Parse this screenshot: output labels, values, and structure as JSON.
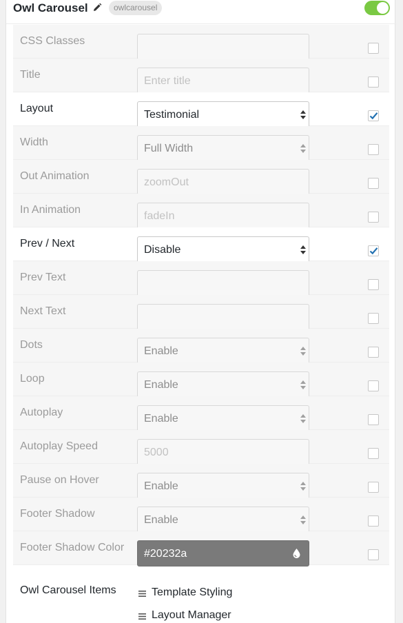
{
  "header": {
    "title": "Owl Carousel",
    "slug": "owlcarousel",
    "enabled": true
  },
  "rows": [
    {
      "label": "CSS Classes",
      "type": "text",
      "value": "",
      "placeholder": "",
      "checked": false
    },
    {
      "label": "Title",
      "type": "text",
      "value": "",
      "placeholder": "Enter title",
      "checked": false
    },
    {
      "label": "Layout",
      "type": "select",
      "value": "Testimonial",
      "placeholder": "",
      "checked": true
    },
    {
      "label": "Width",
      "type": "select",
      "value": "Full Width",
      "placeholder": "",
      "checked": false
    },
    {
      "label": "Out Animation",
      "type": "text",
      "value": "",
      "placeholder": "zoomOut",
      "checked": false
    },
    {
      "label": "In Animation",
      "type": "text",
      "value": "",
      "placeholder": "fadeIn",
      "checked": false
    },
    {
      "label": "Prev / Next",
      "type": "select",
      "value": "Disable",
      "placeholder": "",
      "checked": true
    },
    {
      "label": "Prev Text",
      "type": "text",
      "value": "",
      "placeholder": "",
      "checked": false
    },
    {
      "label": "Next Text",
      "type": "text",
      "value": "",
      "placeholder": "",
      "checked": false
    },
    {
      "label": "Dots",
      "type": "select",
      "value": "Enable",
      "placeholder": "",
      "checked": false
    },
    {
      "label": "Loop",
      "type": "select",
      "value": "Enable",
      "placeholder": "",
      "checked": false
    },
    {
      "label": "Autoplay",
      "type": "select",
      "value": "Enable",
      "placeholder": "",
      "checked": false
    },
    {
      "label": "Autoplay Speed",
      "type": "text",
      "value": "",
      "placeholder": "5000",
      "checked": false
    },
    {
      "label": "Pause on Hover",
      "type": "select",
      "value": "Enable",
      "placeholder": "",
      "checked": false
    },
    {
      "label": "Footer Shadow",
      "type": "select",
      "value": "Enable",
      "placeholder": "",
      "checked": false
    },
    {
      "label": "Footer Shadow Color",
      "type": "color",
      "value": "#20232a",
      "placeholder": "",
      "checked": false
    }
  ],
  "items": {
    "label": "Owl Carousel Items",
    "list": [
      "Template Styling",
      "Layout Manager"
    ]
  },
  "colors": {
    "toggle_on": "#7ac943",
    "check_mark": "#2271b1",
    "color_field_bg": "#7a7a7a"
  }
}
